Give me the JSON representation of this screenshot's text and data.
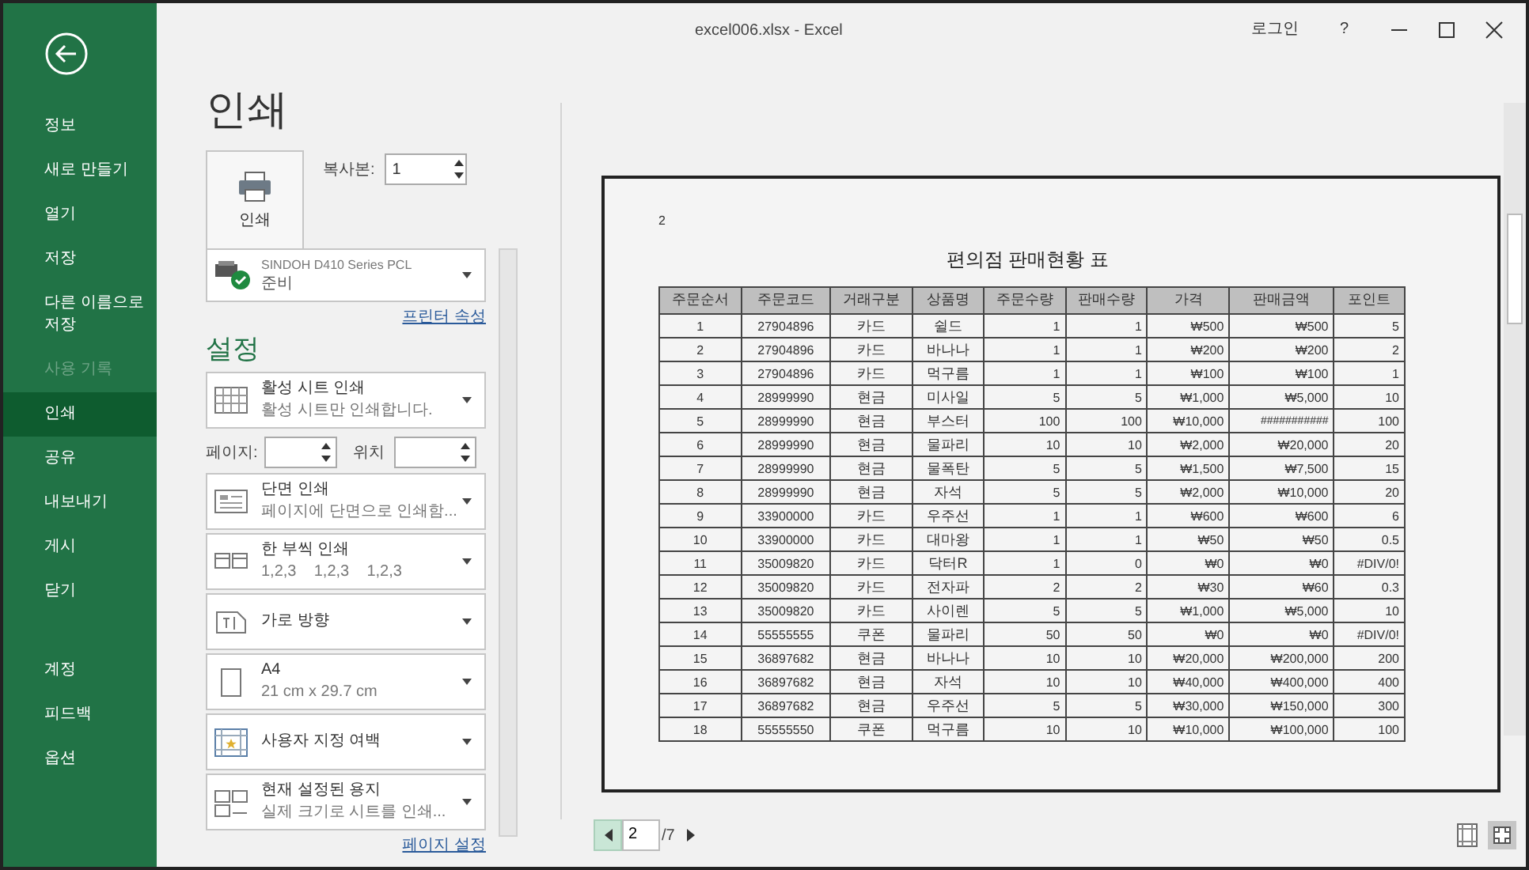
{
  "window": {
    "title": "excel006.xlsx - Excel",
    "account": "로그인",
    "help": "?"
  },
  "sidebar": {
    "items": [
      {
        "label": "정보",
        "selected": false,
        "disabled": false
      },
      {
        "label": "새로 만들기",
        "selected": false,
        "disabled": false
      },
      {
        "label": "열기",
        "selected": false,
        "disabled": false
      },
      {
        "label": "저장",
        "selected": false,
        "disabled": false
      },
      {
        "label": "다른 이름으로 저장",
        "selected": false,
        "disabled": false
      },
      {
        "label": "사용 기록",
        "selected": false,
        "disabled": true
      },
      {
        "label": "인쇄",
        "selected": true,
        "disabled": false
      },
      {
        "label": "공유",
        "selected": false,
        "disabled": false
      },
      {
        "label": "내보내기",
        "selected": false,
        "disabled": false
      },
      {
        "label": "게시",
        "selected": false,
        "disabled": false
      },
      {
        "label": "닫기",
        "selected": false,
        "disabled": false
      }
    ],
    "footer_items": [
      {
        "label": "계정",
        "selected": false,
        "disabled": false
      },
      {
        "label": "피드백",
        "selected": false,
        "disabled": false
      },
      {
        "label": "옵션",
        "selected": false,
        "disabled": false
      }
    ]
  },
  "print": {
    "heading": "인쇄",
    "print_button": "인쇄",
    "copies_label": "복사본:",
    "copies": "1",
    "printer": {
      "name": "SINDOH D410 Series PCL",
      "status": "준비"
    },
    "printer_properties": "프린터 속성",
    "settings_heading": "설정",
    "settings": [
      {
        "kind": "sheets",
        "title": "활성 시트 인쇄",
        "subtitle": "활성 시트만 인쇄합니다."
      },
      {
        "kind": "pages",
        "from_label": "페이지:",
        "to_label": "위치"
      },
      {
        "kind": "sides",
        "title": "단면 인쇄",
        "subtitle": "페이지에 단면으로 인쇄함..."
      },
      {
        "kind": "collate",
        "title": "한 부씩 인쇄",
        "subtitle": "1,2,3    1,2,3    1,2,3"
      },
      {
        "kind": "orientation",
        "title": "가로 방향"
      },
      {
        "kind": "paper",
        "title": "A4",
        "subtitle": "21 cm x 29.7 cm"
      },
      {
        "kind": "margins",
        "title": "사용자 지정 여백"
      },
      {
        "kind": "scaling",
        "title": "현재 설정된 용지",
        "subtitle": "실제 크기로 시트를 인쇄..."
      }
    ],
    "page_setup": "페이지 설정"
  },
  "preview": {
    "page_number": "2",
    "title": "편의점 판매현황 표",
    "table": {
      "columns": [
        "주문순서",
        "주문코드",
        "거래구분",
        "상품명",
        "주문수량",
        "판매수량",
        "가격",
        "판매금액",
        "포인트"
      ],
      "rows": [
        [
          "1",
          "27904896",
          "카드",
          "쉴드",
          "1",
          "1",
          "₩500",
          "₩500",
          "5"
        ],
        [
          "2",
          "27904896",
          "카드",
          "바나나",
          "1",
          "1",
          "₩200",
          "₩200",
          "2"
        ],
        [
          "3",
          "27904896",
          "카드",
          "먹구름",
          "1",
          "1",
          "₩100",
          "₩100",
          "1"
        ],
        [
          "4",
          "28999990",
          "현금",
          "미사일",
          "5",
          "5",
          "₩1,000",
          "₩5,000",
          "10"
        ],
        [
          "5",
          "28999990",
          "현금",
          "부스터",
          "100",
          "100",
          "₩10,000",
          "###########",
          "100"
        ],
        [
          "6",
          "28999990",
          "현금",
          "물파리",
          "10",
          "10",
          "₩2,000",
          "₩20,000",
          "20"
        ],
        [
          "7",
          "28999990",
          "현금",
          "물폭탄",
          "5",
          "5",
          "₩1,500",
          "₩7,500",
          "15"
        ],
        [
          "8",
          "28999990",
          "현금",
          "자석",
          "5",
          "5",
          "₩2,000",
          "₩10,000",
          "20"
        ],
        [
          "9",
          "33900000",
          "카드",
          "우주선",
          "1",
          "1",
          "₩600",
          "₩600",
          "6"
        ],
        [
          "10",
          "33900000",
          "카드",
          "대마왕",
          "1",
          "1",
          "₩50",
          "₩50",
          "0.5"
        ],
        [
          "11",
          "35009820",
          "카드",
          "닥터R",
          "1",
          "0",
          "₩0",
          "₩0",
          "#DIV/0!"
        ],
        [
          "12",
          "35009820",
          "카드",
          "전자파",
          "2",
          "2",
          "₩30",
          "₩60",
          "0.3"
        ],
        [
          "13",
          "35009820",
          "카드",
          "사이렌",
          "5",
          "5",
          "₩1,000",
          "₩5,000",
          "10"
        ],
        [
          "14",
          "55555555",
          "쿠폰",
          "물파리",
          "50",
          "50",
          "₩0",
          "₩0",
          "#DIV/0!"
        ],
        [
          "15",
          "36897682",
          "현금",
          "바나나",
          "10",
          "10",
          "₩20,000",
          "₩200,000",
          "200"
        ],
        [
          "16",
          "36897682",
          "현금",
          "자석",
          "10",
          "10",
          "₩40,000",
          "₩400,000",
          "400"
        ],
        [
          "17",
          "36897682",
          "현금",
          "우주선",
          "5",
          "5",
          "₩30,000",
          "₩150,000",
          "300"
        ],
        [
          "18",
          "55555550",
          "쿠폰",
          "먹구름",
          "10",
          "10",
          "₩10,000",
          "₩100,000",
          "100"
        ]
      ]
    }
  },
  "nav": {
    "current_page": "2",
    "total": "/7"
  }
}
